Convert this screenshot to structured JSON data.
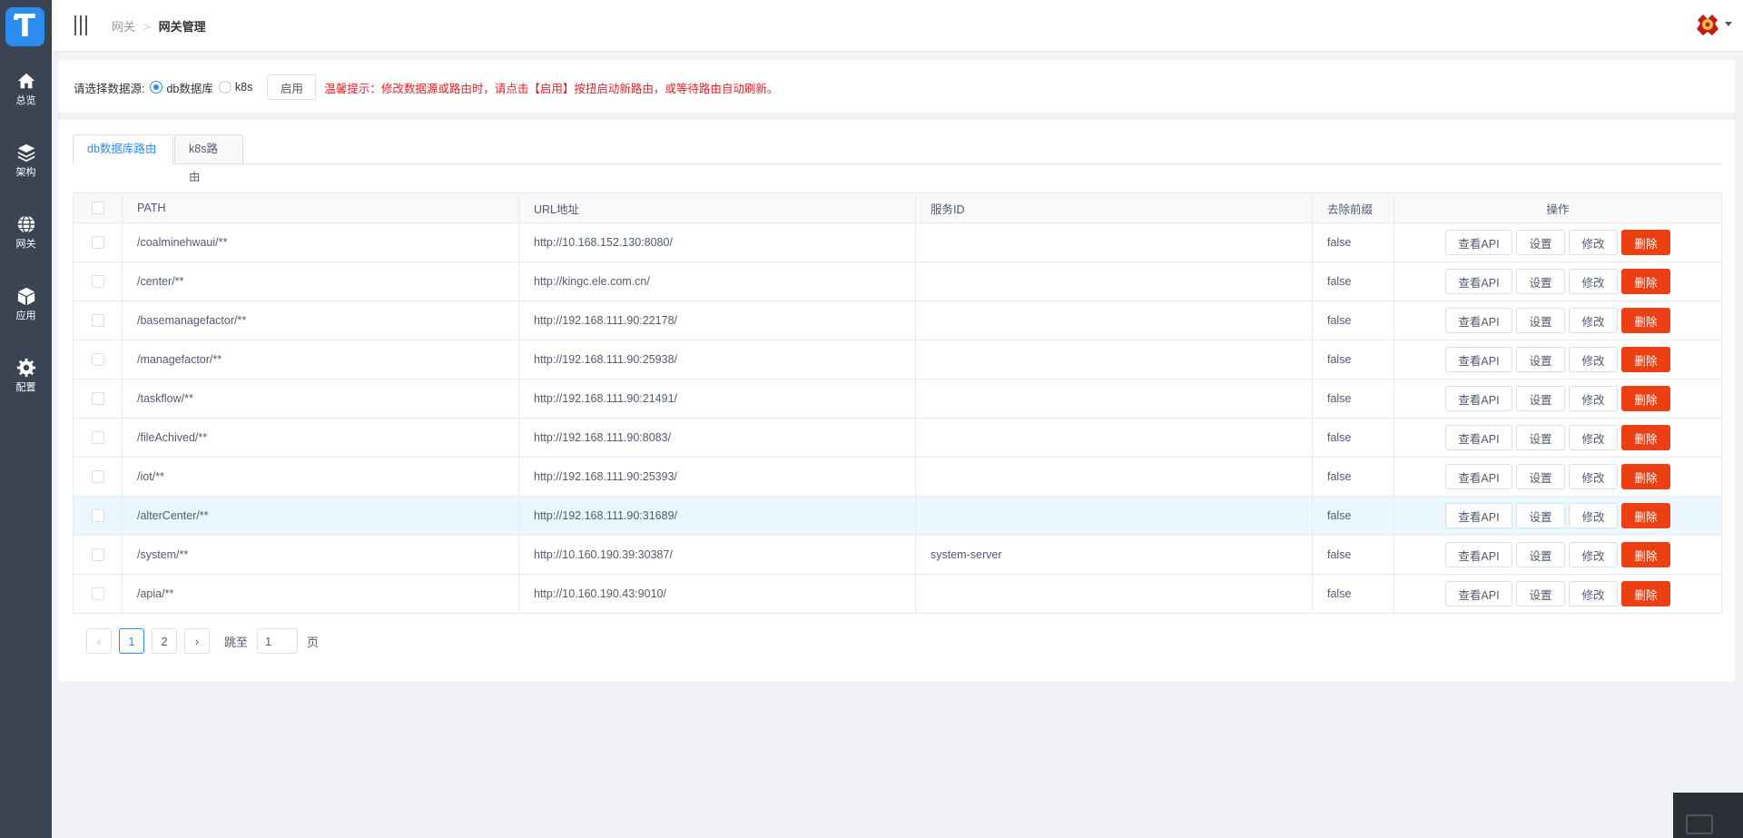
{
  "sidebar": {
    "logo": "T",
    "items": [
      {
        "label": "总览",
        "icon": "home-icon"
      },
      {
        "label": "架构",
        "icon": "layers-icon"
      },
      {
        "label": "网关",
        "icon": "globe-icon"
      },
      {
        "label": "应用",
        "icon": "cube-icon"
      },
      {
        "label": "配置",
        "icon": "gear-icon"
      }
    ]
  },
  "header": {
    "breadcrumb": [
      "网关",
      "网关管理"
    ],
    "separator": ">"
  },
  "source": {
    "label": "请选择数据源:",
    "options": [
      "db数据库",
      "k8s"
    ],
    "selected": "db数据库",
    "enable_label": "启用",
    "tip": "温馨提示：修改数据源或路由时，请点击【启用】按扭启动新路由，或等待路由自动刷新。"
  },
  "tabs": [
    {
      "label": "db数据库路由",
      "active": true
    },
    {
      "label": "k8s路由",
      "active": false
    }
  ],
  "table": {
    "columns": [
      "PATH",
      "URL地址",
      "服务ID",
      "去除前缀",
      "操作"
    ],
    "actions": {
      "api": "查看API",
      "settings": "设置",
      "edit": "修改",
      "delete": "删除"
    },
    "rows": [
      {
        "path": "/coalminehwaui/**",
        "url": "http://10.168.152.130:8080/",
        "service_id": "",
        "strip_prefix": "false"
      },
      {
        "path": "/center/**",
        "url": "http://kingc.ele.com.cn/",
        "service_id": "",
        "strip_prefix": "false"
      },
      {
        "path": "/basemanagefactor/**",
        "url": "http://192.168.111.90:22178/",
        "service_id": "",
        "strip_prefix": "false"
      },
      {
        "path": "/managefactor/**",
        "url": "http://192.168.111.90:25938/",
        "service_id": "",
        "strip_prefix": "false"
      },
      {
        "path": "/taskflow/**",
        "url": "http://192.168.111.90:21491/",
        "service_id": "",
        "strip_prefix": "false"
      },
      {
        "path": "/fileAchived/**",
        "url": "http://192.168.111.90:8083/",
        "service_id": "",
        "strip_prefix": "false"
      },
      {
        "path": "/iot/**",
        "url": "http://192.168.111.90:25393/",
        "service_id": "",
        "strip_prefix": "false"
      },
      {
        "path": "/alterCenter/**",
        "url": "http://192.168.111.90:31689/",
        "service_id": "",
        "strip_prefix": "false",
        "highlighted": true
      },
      {
        "path": "/system/**",
        "url": "http://10.160.190.39:30387/",
        "service_id": "system-server",
        "strip_prefix": "false"
      },
      {
        "path": "/apia/**",
        "url": "http://10.160.190.43:9010/",
        "service_id": "",
        "strip_prefix": "false"
      }
    ]
  },
  "pagination": {
    "prev": "‹",
    "next": "›",
    "pages": [
      "1",
      "2"
    ],
    "current": "1",
    "jump_label": "跳至",
    "jump_value": "1",
    "page_suffix": "页"
  },
  "colors": {
    "sidebar_bg": "#3a4452",
    "accent": "#2d8cf0",
    "danger": "#ed3f14",
    "tip_red": "#ed1c24"
  }
}
